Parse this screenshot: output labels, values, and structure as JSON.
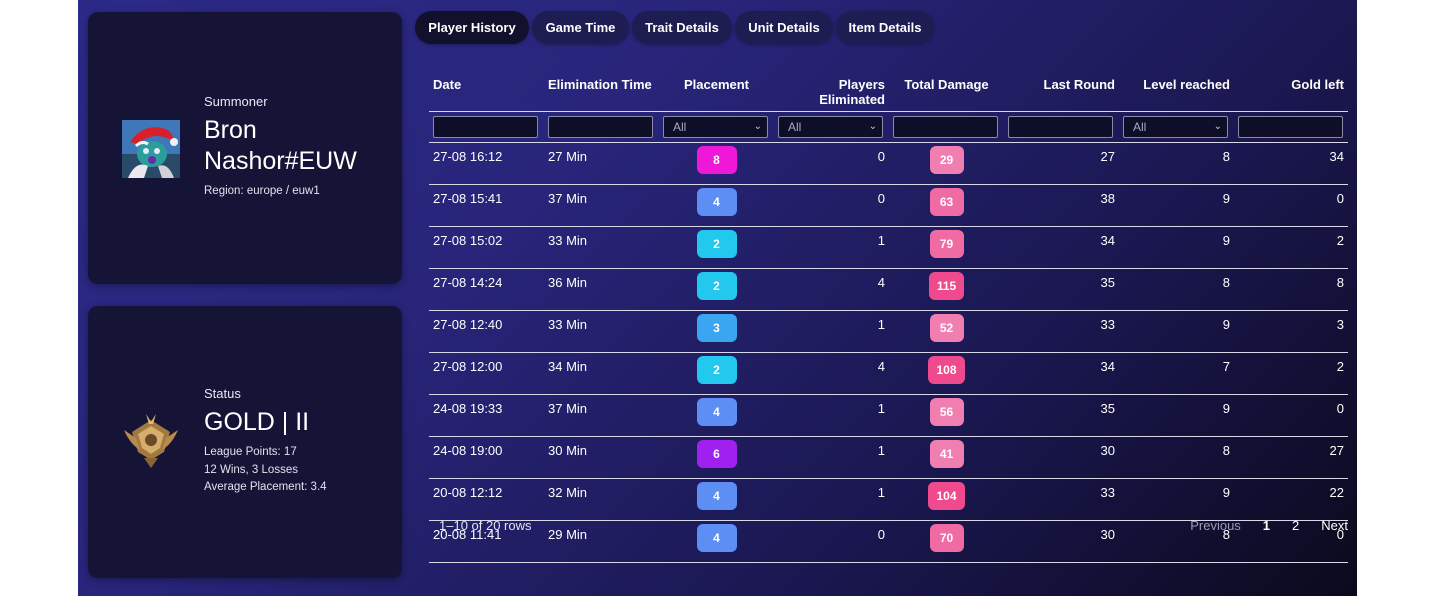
{
  "summoner": {
    "label": "Summoner",
    "name": "Bron Nashor#EUW",
    "region": "Region: europe / euw1",
    "avatar_icon": "summoner-avatar"
  },
  "status": {
    "label": "Status",
    "rank": "GOLD | II",
    "league_points": "League Points: 17",
    "record": "12 Wins, 3 Losses",
    "avg_placement": "Average Placement: 3.4",
    "emblem_icon": "gold-rank-emblem"
  },
  "tabs": [
    {
      "label": "Player History",
      "active": true
    },
    {
      "label": "Game Time",
      "active": false
    },
    {
      "label": "Trait Details",
      "active": false
    },
    {
      "label": "Unit Details",
      "active": false
    },
    {
      "label": "Item Details",
      "active": false
    }
  ],
  "table": {
    "columns": [
      "Date",
      "Elimination Time",
      "Placement",
      "Players Eliminated",
      "Total Damage",
      "Last Round",
      "Level reached",
      "Gold left"
    ],
    "filters": {
      "placement": "All",
      "players_eliminated": "All",
      "level_reached": "All"
    },
    "rows": [
      {
        "date": "27-08 16:12",
        "elim": "27 Min",
        "placement": "8",
        "eliminated": "0",
        "damage": "29",
        "round": "27",
        "level": "8",
        "gold": "34"
      },
      {
        "date": "27-08 15:41",
        "elim": "37 Min",
        "placement": "4",
        "eliminated": "0",
        "damage": "63",
        "round": "38",
        "level": "9",
        "gold": "0"
      },
      {
        "date": "27-08 15:02",
        "elim": "33 Min",
        "placement": "2",
        "eliminated": "1",
        "damage": "79",
        "round": "34",
        "level": "9",
        "gold": "2"
      },
      {
        "date": "27-08 14:24",
        "elim": "36 Min",
        "placement": "2",
        "eliminated": "4",
        "damage": "115",
        "round": "35",
        "level": "8",
        "gold": "8"
      },
      {
        "date": "27-08 12:40",
        "elim": "33 Min",
        "placement": "3",
        "eliminated": "1",
        "damage": "52",
        "round": "33",
        "level": "9",
        "gold": "3"
      },
      {
        "date": "27-08 12:00",
        "elim": "34 Min",
        "placement": "2",
        "eliminated": "4",
        "damage": "108",
        "round": "34",
        "level": "7",
        "gold": "2"
      },
      {
        "date": "24-08 19:33",
        "elim": "37 Min",
        "placement": "4",
        "eliminated": "1",
        "damage": "56",
        "round": "35",
        "level": "9",
        "gold": "0"
      },
      {
        "date": "24-08 19:00",
        "elim": "30 Min",
        "placement": "6",
        "eliminated": "1",
        "damage": "41",
        "round": "30",
        "level": "8",
        "gold": "27"
      },
      {
        "date": "20-08 12:12",
        "elim": "32 Min",
        "placement": "4",
        "eliminated": "1",
        "damage": "104",
        "round": "33",
        "level": "9",
        "gold": "22"
      },
      {
        "date": "20-08 11:41",
        "elim": "29 Min",
        "placement": "4",
        "eliminated": "0",
        "damage": "70",
        "round": "30",
        "level": "8",
        "gold": "0"
      }
    ]
  },
  "badge_colors": {
    "placement_1_2": "#22c8ee",
    "placement_3": "#3aa6f0",
    "placement_4": "#5c8ef4",
    "placement_6": "#a020f0",
    "placement_8": "#f018d8",
    "damage_low": "#f07eb0",
    "damage_mid": "#f06aa4",
    "damage_high": "#f04a8e"
  },
  "footer": {
    "row_count": "1–10 of 20 rows",
    "previous": "Previous",
    "pages": [
      "1",
      "2"
    ],
    "next": "Next"
  }
}
